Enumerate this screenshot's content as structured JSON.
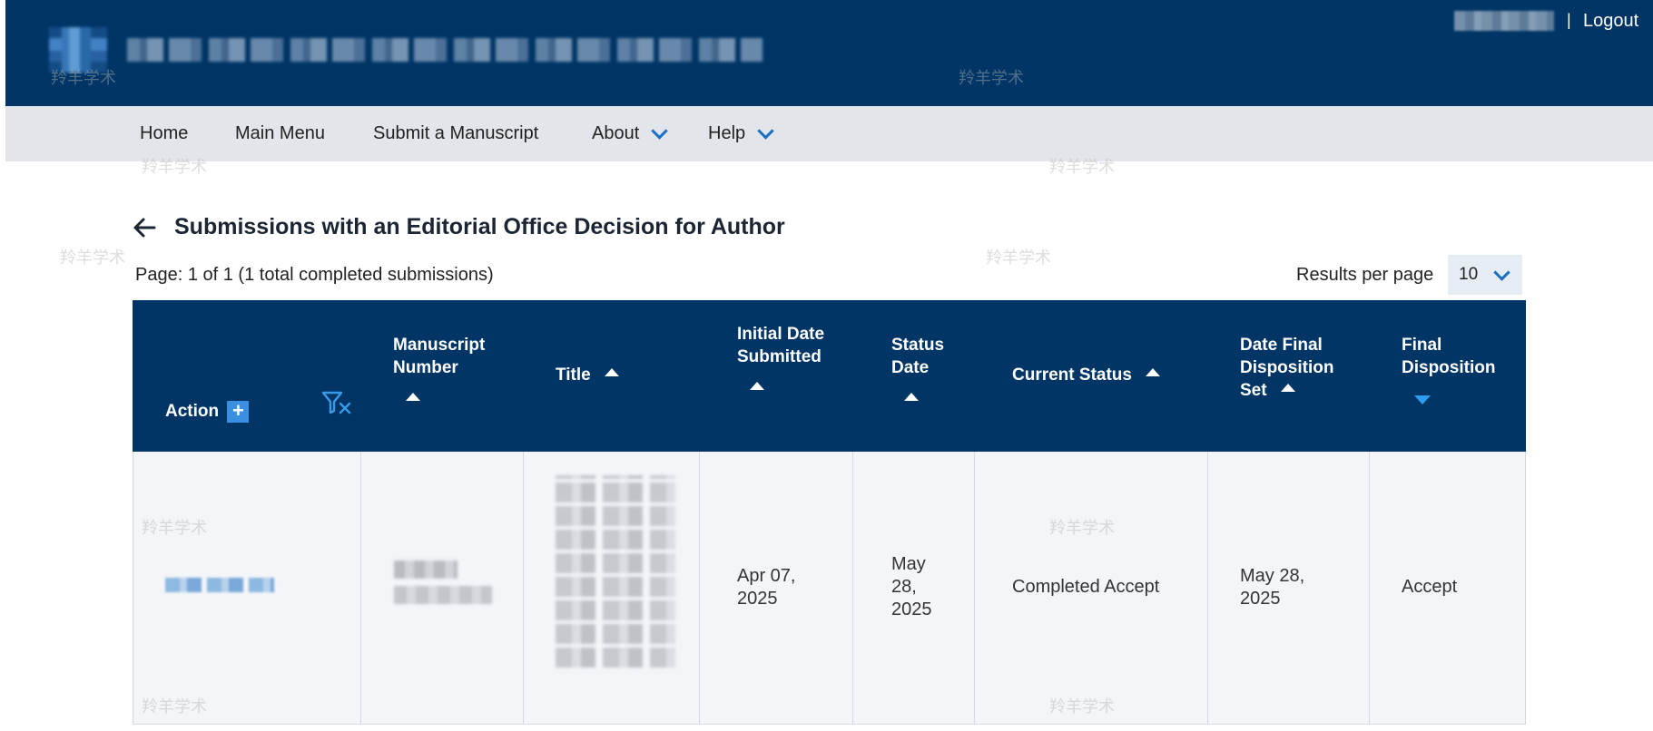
{
  "header": {
    "logout_label": "Logout",
    "separator": "|"
  },
  "nav": {
    "items": [
      {
        "label": "Home",
        "has_dropdown": false
      },
      {
        "label": "Main Menu",
        "has_dropdown": false
      },
      {
        "label": "Submit a Manuscript",
        "has_dropdown": false
      },
      {
        "label": "About",
        "has_dropdown": true
      },
      {
        "label": "Help",
        "has_dropdown": true
      }
    ]
  },
  "page": {
    "title": "Submissions with an Editorial Office Decision for Author",
    "page_info": "Page: 1 of 1 (1 total completed submissions)",
    "results_per_page_label": "Results per page",
    "results_per_page_value": "10"
  },
  "table": {
    "columns": [
      {
        "label": "Action"
      },
      {
        "label": "Manuscript Number"
      },
      {
        "label": "Title"
      },
      {
        "label": "Initial Date Submitted"
      },
      {
        "label": "Status Date"
      },
      {
        "label": "Current Status"
      },
      {
        "label": "Date Final Disposition Set"
      },
      {
        "label": "Final Disposition"
      }
    ],
    "rows": [
      {
        "initial_date_submitted": "Apr 07, 2025",
        "status_date": "May 28, 2025",
        "current_status": "Completed Accept",
        "date_final_disposition_set": "May 28, 2025",
        "final_disposition": "Accept"
      }
    ]
  },
  "watermark": "羚羊学术",
  "colors": {
    "header_bg": "#003566",
    "nav_bg": "#e2e5e9",
    "accent": "#1a6fc2",
    "row_bg": "#f3f5f8"
  },
  "icons": [
    "back-arrow-icon",
    "chevron-down-icon",
    "plus-icon",
    "filter-clear-icon",
    "sort-ascending-icon",
    "sort-descending-icon"
  ]
}
